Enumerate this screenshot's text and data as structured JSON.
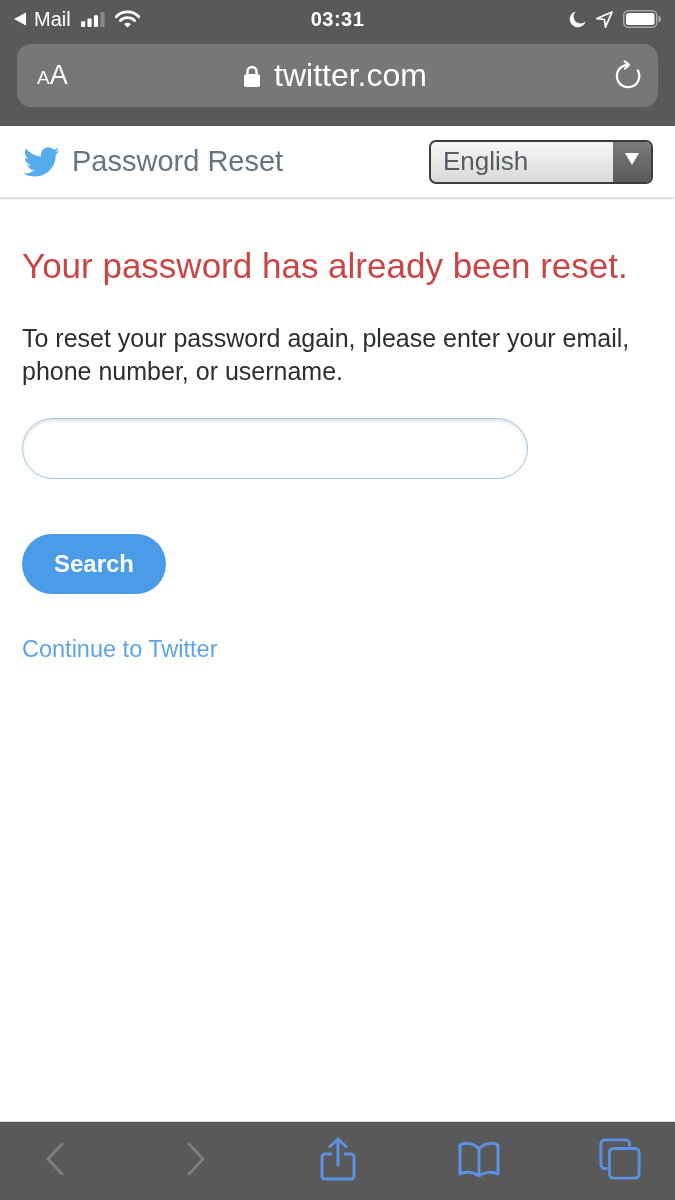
{
  "status_bar": {
    "back_app": "Mail",
    "time": "03:31"
  },
  "browser": {
    "text_size_button": "AA",
    "secure": true,
    "url": "twitter.com"
  },
  "header": {
    "title": "Password Reset",
    "language": "English"
  },
  "content": {
    "error_heading": "Your password has already been reset.",
    "instructions": "To reset your password again, please enter your email, phone number, or username.",
    "search_button": "Search",
    "continue_link": "Continue to Twitter"
  },
  "toolbar": [
    {
      "kind": "back",
      "disabled": true
    },
    {
      "kind": "forward",
      "disabled": true
    },
    {
      "kind": "share",
      "disabled": false
    },
    {
      "kind": "bookmarks",
      "disabled": false
    },
    {
      "kind": "tabs",
      "disabled": false
    }
  ]
}
